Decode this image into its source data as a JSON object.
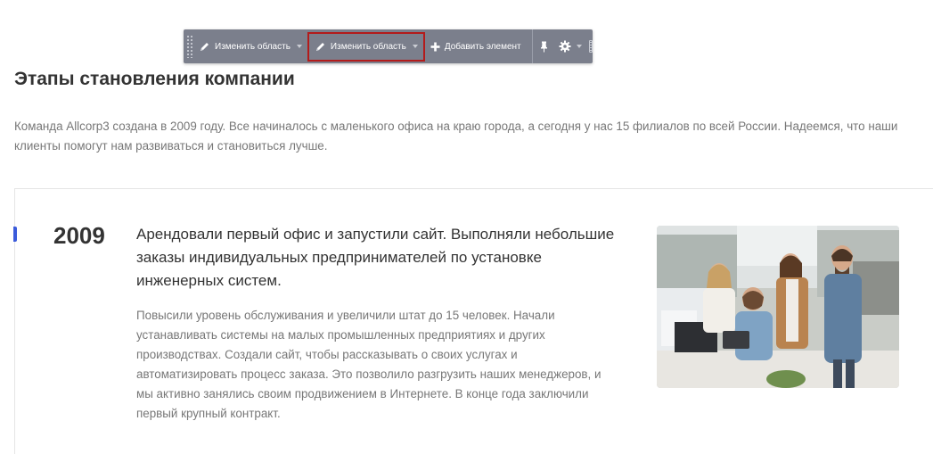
{
  "toolbar": {
    "items": [
      {
        "label": "Изменить область",
        "icon": "pencil-icon",
        "has_dropdown": true
      },
      {
        "label": "Изменить область",
        "icon": "pencil-icon",
        "has_dropdown": true,
        "selected": true
      },
      {
        "label": "Добавить элемент",
        "icon": "plus-icon",
        "has_dropdown": false
      }
    ],
    "tools": [
      "pin-icon",
      "gear-icon"
    ],
    "selected_outline_color": "#b31b1b",
    "background_color": "#7b7f8c"
  },
  "page": {
    "title": "Этапы становления компании",
    "intro": "Команда Allcorp3 создана в 2009 году. Все начиналось с маленького офиса на краю города, а сегодня у нас 15 филиалов по всей России. Надеемся, что наши клиенты помогут нам развиваться и становиться лучше."
  },
  "timeline": {
    "accent_color": "#3b5bdb",
    "events": [
      {
        "year": "2009",
        "title": "Арендовали первый офис и запустили сайт. Выполняли небольшие заказы индивидуальных предпринимателей по установке инженерных систем.",
        "description": "Повысили уровень обслуживания и увеличили штат до 15 человек. Начали устанавливать системы на малых промышленных предприятиях и других производствах. Создали сайт, чтобы рассказывать о своих услугах и автоматизировать процесс заказа. Это позволило разгрузить наших менеджеров, и мы активно занялись своим продвижением в Интернете. В конце года заключили первый крупный контракт.",
        "image": "office-team-photo"
      }
    ]
  }
}
